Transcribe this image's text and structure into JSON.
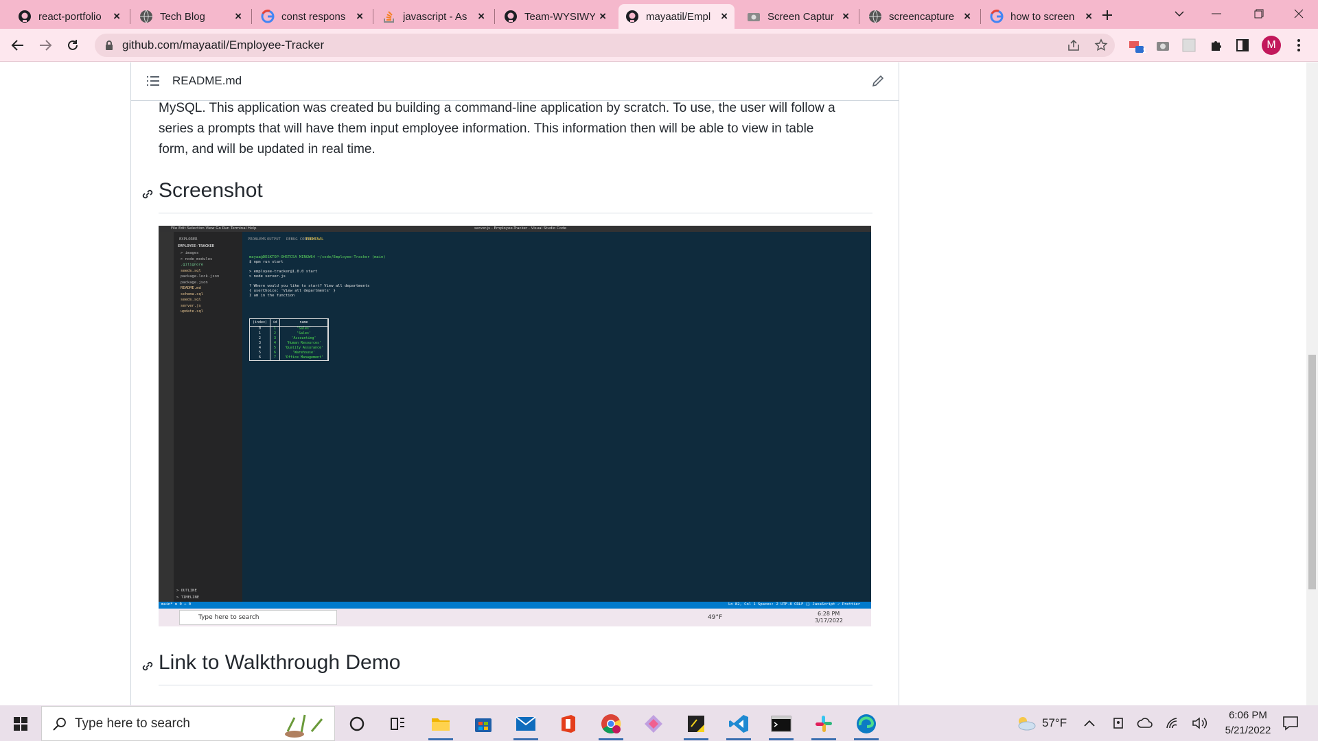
{
  "tabs": [
    {
      "title": "react-portfolio",
      "icon": "github-icon"
    },
    {
      "title": "Tech Blog",
      "icon": "globe-icon"
    },
    {
      "title": "const respons",
      "icon": "google-icon"
    },
    {
      "title": "javascript - As",
      "icon": "stackoverflow-icon"
    },
    {
      "title": "Team-WYSIWY",
      "icon": "github-icon"
    },
    {
      "title": "mayaatil/Empl",
      "icon": "github-icon",
      "active": true
    },
    {
      "title": "Screen Captur",
      "icon": "camera-icon"
    },
    {
      "title": "screencapture",
      "icon": "globe-icon"
    },
    {
      "title": "how to screen",
      "icon": "google-icon"
    }
  ],
  "address_bar": {
    "url": "github.com/mayaatil/Employee-Tracker"
  },
  "profile": {
    "initial": "M",
    "color": "#c2185b"
  },
  "extension_badge": "1",
  "readme": {
    "filename": "README.md",
    "intro_lines": [
      "MySQL. This application was created bu building a command-line application by scratch. To use, the user will follow a",
      "series a prompts that will have them input employee information. This information then will be able to view in table",
      "form, and will be updated in real time."
    ],
    "screenshot_heading": "Screenshot",
    "walkthrough_heading": "Link to Walkthrough Demo"
  },
  "embedded_screenshot": {
    "menu": [
      "File",
      "Edit",
      "Selection",
      "View",
      "Go",
      "Run",
      "Terminal",
      "Help"
    ],
    "window_title": "server.js - Employee-Tracker - Visual Studio Code",
    "explorer_title": "EXPLORER",
    "project": "EMPLOYEE-TRACKER",
    "files": [
      {
        "name": "> images",
        "color": "#b5b5b5"
      },
      {
        "name": "> node_modules",
        "color": "#b5b5b5"
      },
      {
        "name": ".gitignore",
        "color": "#73c991"
      },
      {
        "name": "seeds.sql",
        "color": "#e2c08d"
      },
      {
        "name": "package-lock.json",
        "color": "#b5b5b5"
      },
      {
        "name": "package.json",
        "color": "#b5b5b5"
      },
      {
        "name": "README.md",
        "color": "#e2c08d"
      },
      {
        "name": "schema.sql",
        "color": "#e2c08d"
      },
      {
        "name": "seeds.sql",
        "color": "#e2c08d"
      },
      {
        "name": "server.js",
        "color": "#e2c08d"
      },
      {
        "name": "update.sql",
        "color": "#e2c08d"
      }
    ],
    "panel_tabs": [
      "PROBLEMS",
      "OUTPUT",
      "DEBUG CONSOLE",
      "TERMINAL"
    ],
    "terminal_lines": [
      {
        "text": "mayaa@DESKTOP-OH5TC5A MINGW64 ~/code/Employee-Tracker (main)",
        "color": "#5dd55d"
      },
      {
        "text": "$ npm run start",
        "color": "#e0e0e0"
      },
      {
        "text": "",
        "color": "#e0e0e0"
      },
      {
        "text": "> employee-tracker@1.0.0 start",
        "color": "#e0e0e0"
      },
      {
        "text": "> node server.js",
        "color": "#e0e0e0"
      },
      {
        "text": "",
        "color": "#e0e0e0"
      },
      {
        "text": "? Where would you like to start? View all departments",
        "color": "#e0e0e0"
      },
      {
        "text": "{ userChoice: 'View all departments' }",
        "color": "#e0e0e0"
      },
      {
        "text": "I am in the function",
        "color": "#e0e0e0"
      }
    ],
    "table": {
      "headers": [
        "(index)",
        "id",
        "name"
      ],
      "rows": [
        [
          "0",
          "1",
          "'Sales'"
        ],
        [
          "1",
          "2",
          "'Sales'"
        ],
        [
          "2",
          "3",
          "'Accounting'"
        ],
        [
          "3",
          "4",
          "'Human Resources'"
        ],
        [
          "4",
          "5",
          "'Quality Assurance'"
        ],
        [
          "5",
          "6",
          "'Warehouse'"
        ],
        [
          "6",
          "7",
          "'Office Management'"
        ]
      ]
    },
    "outline_items": [
      "> OUTLINE",
      "> TIMELINE"
    ],
    "status_left": "main*  ⊗ 0 ⚠ 0",
    "status_right": "Ln 82, Col 1   Spaces: 2   UTF-8   CRLF   {} JavaScript   ✓ Prettier",
    "taskbar_search": "Type here to search",
    "weather": "49°F",
    "time": "6:28 PM",
    "date": "3/17/2022"
  },
  "taskbar": {
    "search_placeholder": "Type here to search",
    "weather": "57°F",
    "time": "6:06 PM",
    "date": "5/21/2022"
  }
}
